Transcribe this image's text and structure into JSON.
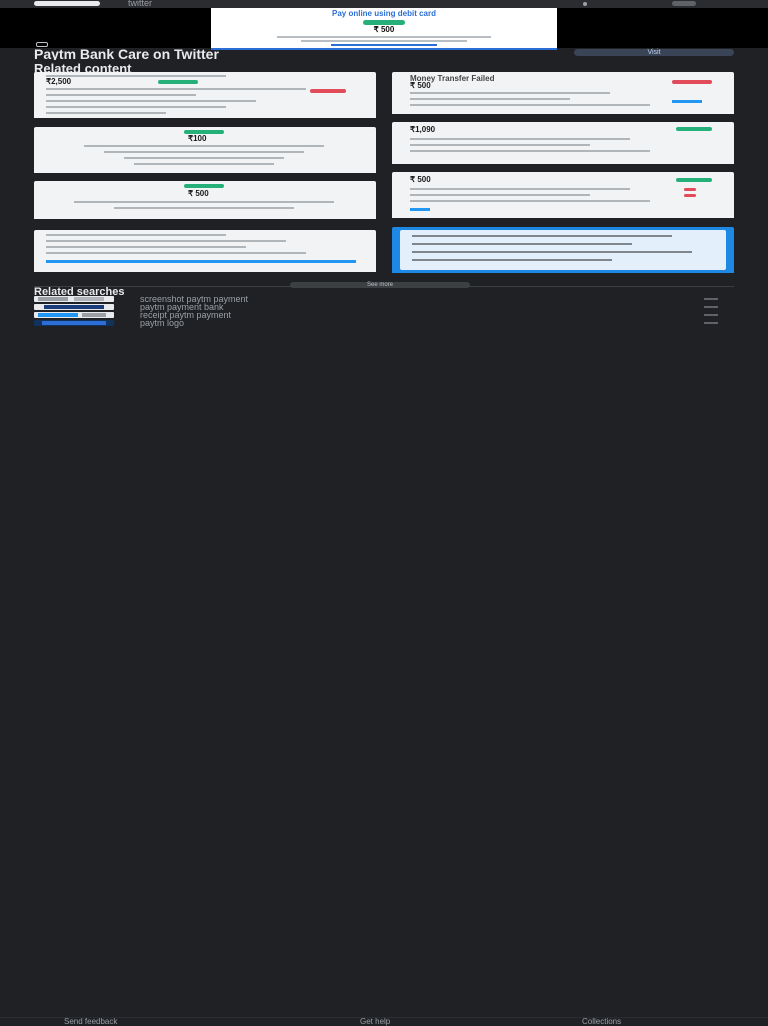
{
  "topbar": {
    "site": "twitter"
  },
  "hero": {
    "headline": "Pay online using debit card",
    "amount": "₹ 500"
  },
  "header": {
    "title": "Paytm Bank Care on Twitter",
    "visit_label": "Visit"
  },
  "related": {
    "heading": "Related content",
    "cards": [
      {
        "amount": "₹2,500"
      },
      {
        "headline": "Money Transfer Failed",
        "amount": "₹ 500"
      },
      {
        "amount": "₹100"
      },
      {
        "amount": "₹1,090"
      },
      {
        "amount": "₹ 500"
      },
      {
        "amount": "₹ 500"
      },
      {},
      {}
    ],
    "see_more_label": "See more"
  },
  "searches": {
    "heading": "Related searches",
    "items": [
      {
        "label": "screenshot paytm payment"
      },
      {
        "label": "paytm payment bank"
      },
      {
        "label": "receipt paytm payment"
      },
      {
        "label": "paytm logo"
      }
    ]
  },
  "footer": {
    "left": "Send feedback",
    "middle": "Get help",
    "right": "Collections"
  },
  "colors": {
    "page_bg": "#202124",
    "accent_green": "#25b07a",
    "accent_blue": "#2196f3",
    "alert_red": "#e14b5a",
    "link_blue": "#2b6fd6"
  },
  "icons": {
    "back": "chevron-left-icon",
    "arrow": "arrow-right-icon",
    "twitter": "twitter-logo"
  }
}
